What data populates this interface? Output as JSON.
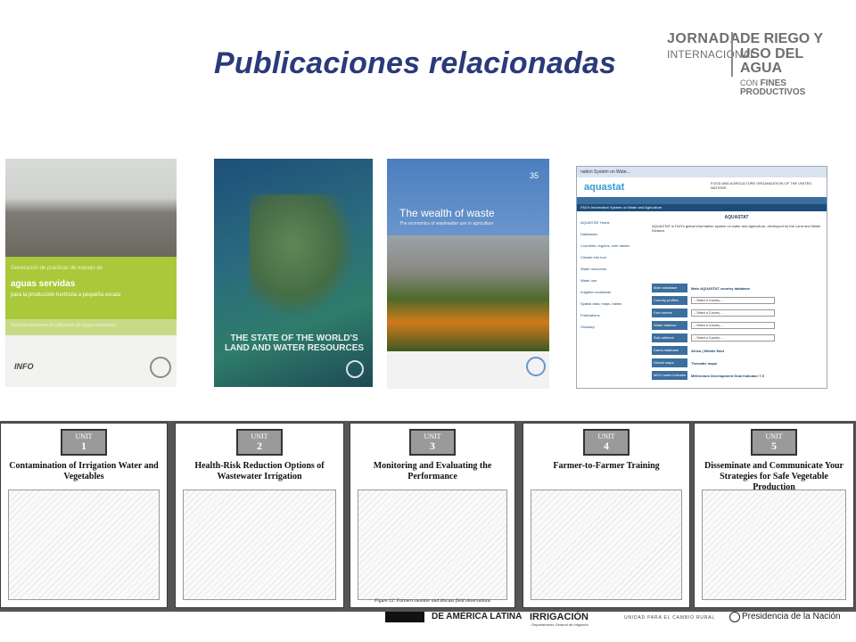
{
  "slide": {
    "title": "Publicaciones relacionadas"
  },
  "event_logo": {
    "line1": "JORNADA",
    "line2": "INTERNACIONAL",
    "line3": "DE RIEGO Y",
    "line4": "USO DEL AGUA",
    "line5_prefix": "CON",
    "line5_bold": "FINES PRODUCTIVOS"
  },
  "covers": {
    "c1": {
      "kicker": "Generación de prácticas de manejo de",
      "title": "aguas servidas",
      "subtitle": "para la producción hortícola a pequeña escala",
      "footer_line": "Recomendaciones de utilización de aguas residuales",
      "publisher": "INFO"
    },
    "c2": {
      "title": "THE STATE OF THE WORLD'S LAND AND WATER RESOURCES"
    },
    "c3": {
      "number": "35",
      "title": "The wealth of waste",
      "subtitle": "The economics of wastewater use in agriculture"
    },
    "c4": {
      "browser_tab": "nation System on Wate...",
      "brand": "aquastat",
      "tagline": "FOOD AND AGRICULTURE ORGANIZATION OF THE UNITED NATIONS",
      "subheader": "FAO's Information System on Water and Agriculture",
      "main_heading": "AQUASTAT",
      "intro": "AQUASTAT is FAO's global information system on water and agriculture, developed by the Land and Water Division.",
      "sidebar": [
        "AQUASTAT Home",
        "Databases",
        "Countries, regions, river basins",
        "Climate info tool",
        "Water resources",
        "Water use",
        "Irrigation worldwide",
        "Spatial data, maps, tables",
        "Publications",
        "Glossary"
      ],
      "rows": [
        {
          "label": "Main database",
          "value": "Main AQUASTAT country database"
        },
        {
          "label": "Country profiles",
          "value": "-- Select a Country --"
        },
        {
          "label": "Fact sheets",
          "value": "-- Select a Country --"
        },
        {
          "label": "Water balance sheets",
          "value": "-- Select a Country --"
        },
        {
          "label": "Sub-national irrigation",
          "value": "-- Select a Country --"
        },
        {
          "label": "Dams database",
          "value": "Africa | Middle East"
        },
        {
          "label": "Global maps",
          "value": "Thematic maps"
        },
        {
          "label": "MDG water indicator",
          "value": "Millennium Development Goal Indicator 7.5"
        }
      ]
    }
  },
  "units": [
    {
      "unit_label": "UNIT",
      "number": "1",
      "title": "Contamination of Irrigation Water and Vegetables",
      "caption": ""
    },
    {
      "unit_label": "UNIT",
      "number": "2",
      "title": "Health-Risk Reduction Options of Wastewater Irrigation",
      "caption": ""
    },
    {
      "unit_label": "UNIT",
      "number": "3",
      "title": "Monitoring and Evaluating the Performance",
      "caption": "Figure 12: Farmers monitor and discuss field observations"
    },
    {
      "unit_label": "UNIT",
      "number": "4",
      "title": "Farmer-to-Farmer Training",
      "caption": ""
    },
    {
      "unit_label": "UNIT",
      "number": "5",
      "title": "Disseminate and Communicate Your Strategies for Safe Vegetable Production",
      "caption": ""
    }
  ],
  "footer": {
    "f1": "DE AMÉRICA LATINA",
    "f2": "IRRIGACIÓN",
    "f3": "Departamento General de Irrigación",
    "f4": "UNIDAD PARA EL CAMBIO RURAL",
    "f5": "Presidencia de la Nación"
  }
}
